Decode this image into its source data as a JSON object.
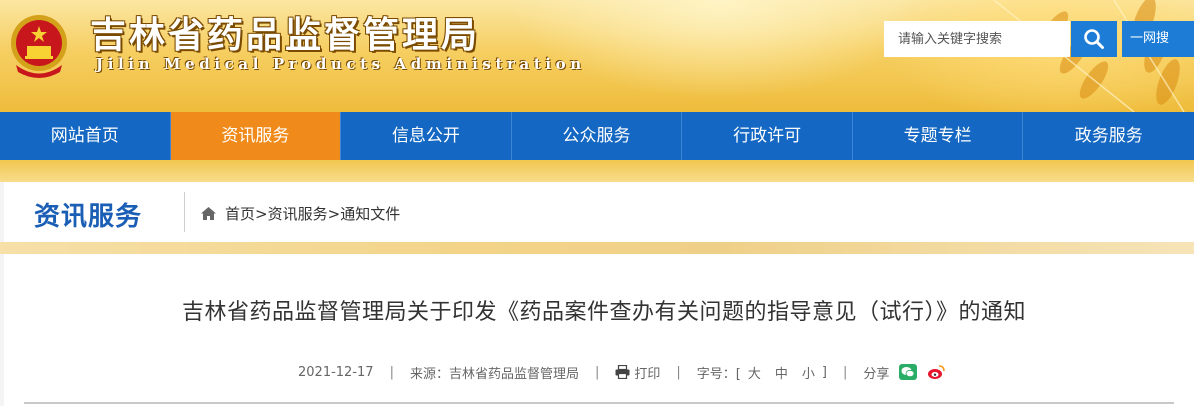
{
  "header": {
    "site_title": "吉林省药品监督管理局",
    "site_subtitle": "Jilin Medical Products Administration",
    "search_placeholder": "请输入关键字搜索",
    "one_net_label": "一网搜"
  },
  "nav": {
    "items": [
      {
        "label": "网站首页"
      },
      {
        "label": "资讯服务"
      },
      {
        "label": "信息公开"
      },
      {
        "label": "公众服务"
      },
      {
        "label": "行政许可"
      },
      {
        "label": "专题专栏"
      },
      {
        "label": "政务服务"
      }
    ],
    "active_index": 1
  },
  "section": {
    "title": "资讯服务",
    "breadcrumb": {
      "home": "首页",
      "sep1": ">",
      "level1": "资讯服务",
      "sep2": ">",
      "level2": "通知文件"
    }
  },
  "article": {
    "title": "吉林省药品监督管理局关于印发《药品案件查办有关问题的指导意见（试行）》的通知",
    "date": "2021-12-17",
    "source_label": "来源：",
    "source": "吉林省药品监督管理局",
    "print_label": "打印",
    "font_label": "字号：[",
    "font_large": "大",
    "font_medium": "中",
    "font_small": "小",
    "font_close": "]",
    "share_label": "分享",
    "sep": "|"
  },
  "colors": {
    "nav_blue": "#1467c2",
    "nav_active_orange": "#f08a1a",
    "section_title_blue": "#1b5eb5",
    "search_button_blue": "#1d7dd6",
    "wechat_green": "#2aae67",
    "weibo_red": "#e6162d"
  },
  "icons": [
    "national-emblem-icon",
    "search-icon",
    "home-icon",
    "printer-icon",
    "wechat-icon",
    "weibo-icon"
  ]
}
